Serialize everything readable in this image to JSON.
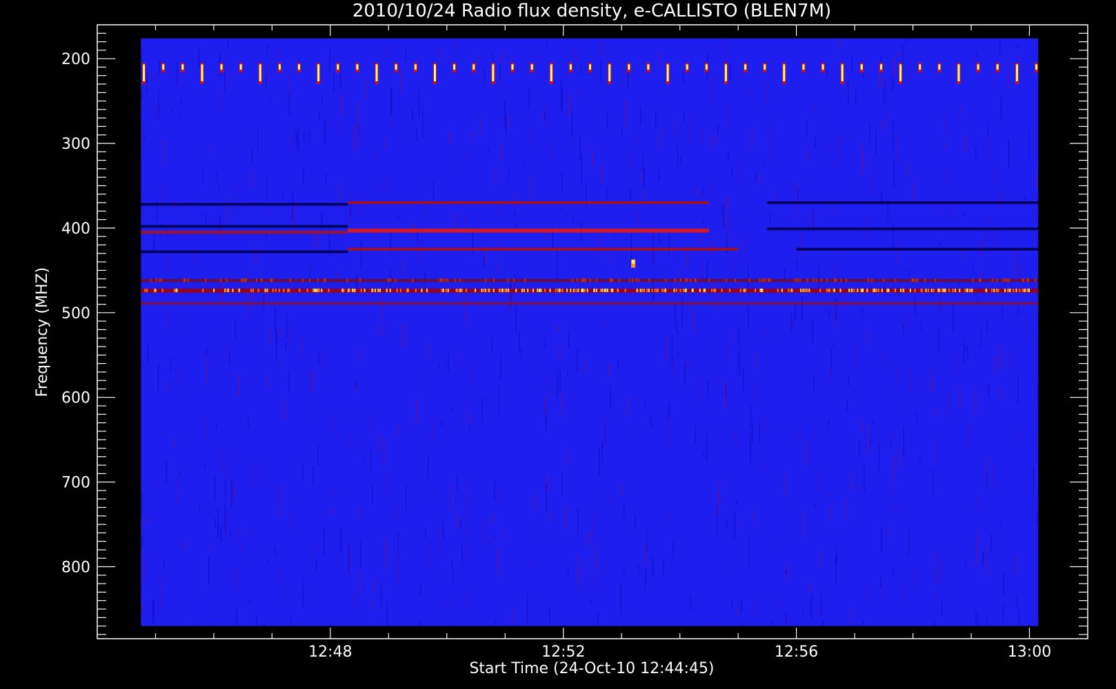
{
  "chart_data": {
    "type": "heatmap",
    "title": "2010/10/24  Radio flux density, e-CALLISTO (BLEN7M)",
    "xlabel": "Start Time (24-Oct-10 12:44:45)",
    "ylabel": "Frequency (MHZ)",
    "x_ticks": [
      "12:48",
      "12:52",
      "12:56",
      "13:00"
    ],
    "y_ticks": [
      "200",
      "300",
      "400",
      "500",
      "600",
      "700",
      "800"
    ],
    "x_tick_minutes": [
      48,
      52,
      56,
      60
    ],
    "y_tick_values": [
      200,
      300,
      400,
      500,
      600,
      700,
      800
    ],
    "xlim_minutes": [
      44.75,
      60.15
    ],
    "ylim_mhz": [
      176,
      870
    ],
    "axis_xlim_minutes": [
      44.0,
      61.0
    ],
    "axis_ylim_mhz": [
      160,
      885
    ],
    "y_inverted": true,
    "colormap": [
      "#000000",
      "#1010ff",
      "#b00000",
      "#ff3000",
      "#ffff60"
    ],
    "background_color": "#1e1eef",
    "features": [
      {
        "type": "periodic_burst",
        "freq_mhz": [
          205,
          230
        ],
        "period_minutes": 0.333
      },
      {
        "type": "band",
        "freq_mhz": 372,
        "x_from": 44.75,
        "x_to": 48.3,
        "level": "dark"
      },
      {
        "type": "band",
        "freq_mhz": 398,
        "x_from": 44.75,
        "x_to": 48.3,
        "level": "dark"
      },
      {
        "type": "band",
        "freq_mhz": 405,
        "x_from": 44.75,
        "x_to": 48.3,
        "level": "red"
      },
      {
        "type": "band",
        "freq_mhz": 428,
        "x_from": 44.75,
        "x_to": 48.3,
        "level": "dark"
      },
      {
        "type": "band",
        "freq_mhz": 370,
        "x_from": 48.3,
        "x_to": 54.5,
        "level": "red"
      },
      {
        "type": "band",
        "freq_mhz": 403,
        "x_from": 48.3,
        "x_to": 54.5,
        "level": "bright_red"
      },
      {
        "type": "band",
        "freq_mhz": 425,
        "x_from": 48.3,
        "x_to": 55.0,
        "level": "red"
      },
      {
        "type": "band",
        "freq_mhz": 370,
        "x_from": 55.5,
        "x_to": 60.15,
        "level": "dark"
      },
      {
        "type": "band",
        "freq_mhz": 401,
        "x_from": 55.5,
        "x_to": 60.15,
        "level": "dark"
      },
      {
        "type": "band",
        "freq_mhz": 425,
        "x_from": 56.0,
        "x_to": 60.15,
        "level": "dark"
      },
      {
        "type": "band",
        "freq_mhz": 462,
        "x_from": 44.75,
        "x_to": 60.15,
        "level": "speckle"
      },
      {
        "type": "band",
        "freq_mhz": 474,
        "x_from": 44.75,
        "x_to": 60.15,
        "level": "bright_speckle"
      },
      {
        "type": "band",
        "freq_mhz": 489,
        "x_from": 44.75,
        "x_to": 60.15,
        "level": "faint_red"
      },
      {
        "type": "hotspot",
        "freq_mhz": 442,
        "x_minutes": 53.2
      }
    ]
  }
}
